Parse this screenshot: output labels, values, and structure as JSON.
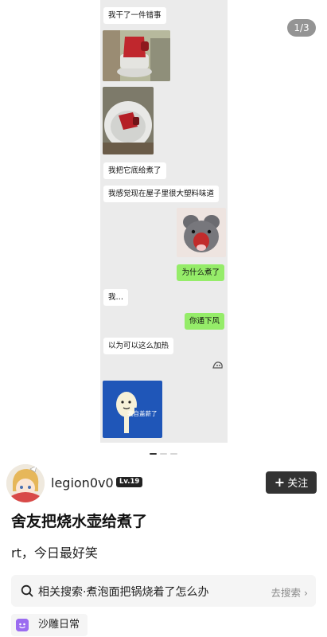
{
  "carousel": {
    "counter": "1/3",
    "page_count": 3,
    "current_page": 1,
    "chat": {
      "messages": [
        {
          "side": "left",
          "text": "我干了一件错事"
        },
        {
          "side": "left",
          "text": "我把它底给煮了"
        },
        {
          "side": "left",
          "text": "我感觉现在屋子里很大塑料味道"
        },
        {
          "side": "right",
          "text": "为什么煮了"
        },
        {
          "side": "left",
          "text": "我…"
        },
        {
          "side": "right",
          "text": "你通下风"
        },
        {
          "side": "left",
          "text": "以为可以这么加热"
        }
      ],
      "sticker_caption": "我自盖薪了"
    }
  },
  "author": {
    "username": "legion0v0",
    "level": "Lv.19",
    "follow_label": "关注"
  },
  "post": {
    "title": "舍友把烧水壶给煮了",
    "body": "rt，今日最好笑"
  },
  "related_search": {
    "text": "相关搜索·煮泡面把锅烧着了怎么办",
    "action": "去搜索"
  },
  "topic": {
    "label": "沙雕日常"
  },
  "colors": {
    "wechat_green": "#95ec69",
    "chat_bg": "#ebebeb",
    "follow_bg": "#333333",
    "topic_purple": "#9b6cf0"
  }
}
